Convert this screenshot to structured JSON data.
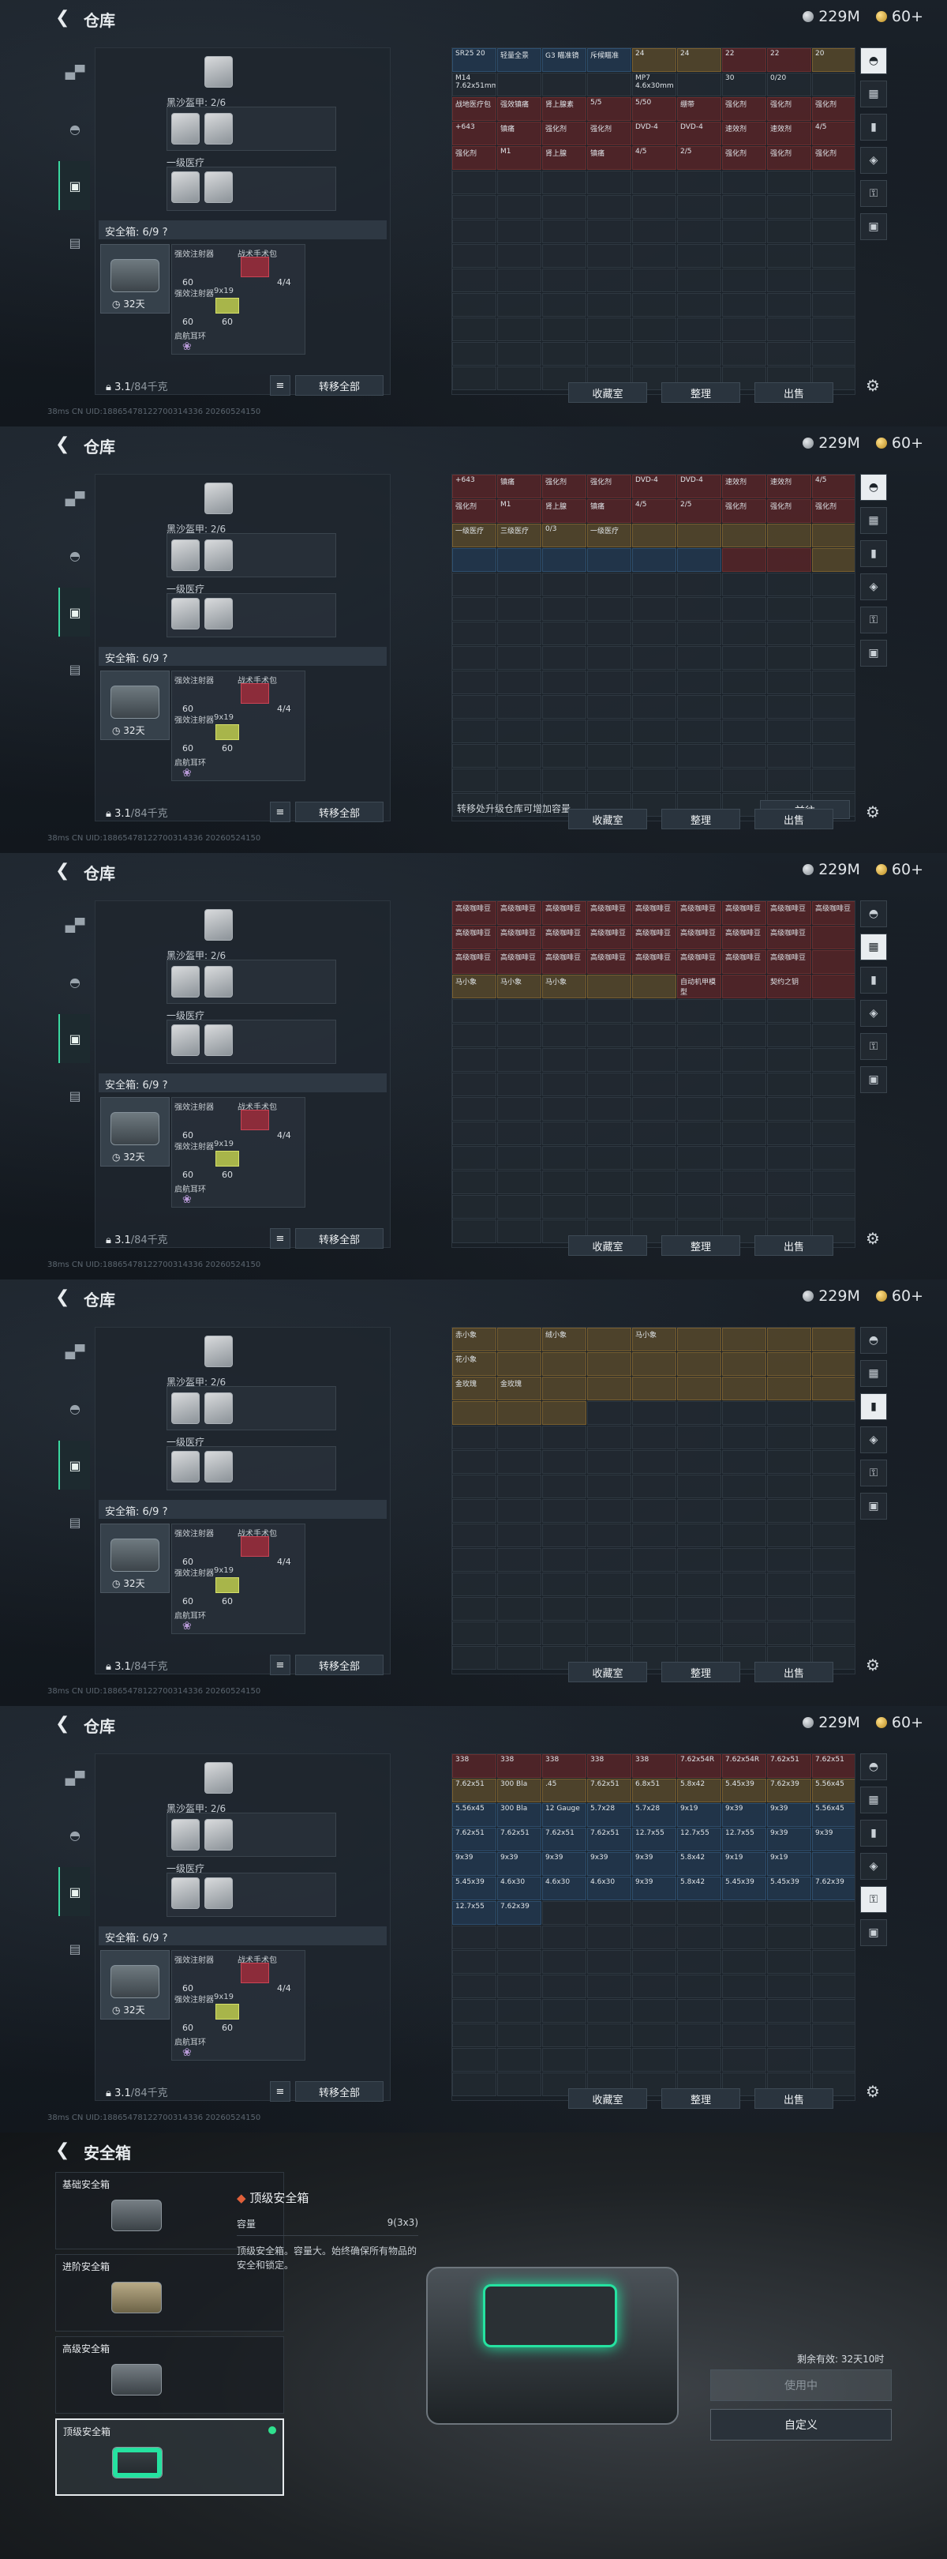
{
  "app": {
    "warehouse_title": "仓库",
    "safe_title": "安全箱",
    "silver": "229M",
    "gold": "60+",
    "uid_text": "CN UID:18865478122700314336 20260524150",
    "ping": "38ms"
  },
  "left_panel": {
    "rig_label": "黑沙盔甲: 2/6",
    "pouch_label": "一级医疗",
    "safe_label": "安全箱: 6/9 ?",
    "safe_time": "32天",
    "items": [
      {
        "name": "强效注射器",
        "count": "60"
      },
      {
        "name": "战术手术包",
        "count": "4/4"
      },
      {
        "name": "强效注射器",
        "count": "60"
      },
      {
        "name": "9x19",
        "count": "60"
      },
      {
        "name": "启航耳环",
        "count": ""
      }
    ],
    "weight": "3.1",
    "weight_max": "/84千克",
    "transfer_all": "转移全部"
  },
  "right_buttons": {
    "stash": "收藏室",
    "sort": "整理",
    "sell": "出售",
    "next": "前往"
  },
  "frames": [
    {
      "note": "",
      "tiles": [
        {
          "t": "SR25 20",
          "c": "blue"
        },
        {
          "t": "轻量全景",
          "c": "blue"
        },
        {
          "t": "G3 瞄准镜",
          "c": "blue"
        },
        {
          "t": "斥候瞄准",
          "c": "blue"
        },
        {
          "t": "24",
          "c": "gold"
        },
        {
          "t": "24",
          "c": "gold"
        },
        {
          "t": "22",
          "c": "red"
        },
        {
          "t": "22",
          "c": "red"
        },
        {
          "t": "20",
          "c": "gold"
        },
        {
          "t": "M14 7.62x51mm",
          "c": ""
        },
        {
          "t": "",
          "c": ""
        },
        {
          "t": "",
          "c": ""
        },
        {
          "t": "",
          "c": ""
        },
        {
          "t": "MP7 4.6x30mm",
          "c": ""
        },
        {
          "t": "",
          "c": ""
        },
        {
          "t": "30",
          "c": ""
        },
        {
          "t": "0/20",
          "c": ""
        },
        {
          "t": "",
          "c": ""
        },
        {
          "t": "战地医疗包",
          "c": "red"
        },
        {
          "t": "强效镇痛",
          "c": "red"
        },
        {
          "t": "肾上腺素",
          "c": "red"
        },
        {
          "t": "5/5",
          "c": "red"
        },
        {
          "t": "5/50",
          "c": "red"
        },
        {
          "t": "绷带",
          "c": "red"
        },
        {
          "t": "强化剂",
          "c": "red"
        },
        {
          "t": "强化剂",
          "c": "red"
        },
        {
          "t": "强化剂",
          "c": "red"
        },
        {
          "t": "+643",
          "c": "red"
        },
        {
          "t": "镇痛",
          "c": "red"
        },
        {
          "t": "强化剂",
          "c": "red"
        },
        {
          "t": "强化剂",
          "c": "red"
        },
        {
          "t": "DVD-4",
          "c": "red"
        },
        {
          "t": "DVD-4",
          "c": "red"
        },
        {
          "t": "速效剂",
          "c": "red"
        },
        {
          "t": "速效剂",
          "c": "red"
        },
        {
          "t": "4/5",
          "c": "red"
        },
        {
          "t": "强化剂",
          "c": "red"
        },
        {
          "t": "M1",
          "c": "red"
        },
        {
          "t": "肾上腺",
          "c": "red"
        },
        {
          "t": "镇痛",
          "c": "red"
        },
        {
          "t": "4/5",
          "c": "red"
        },
        {
          "t": "2/5",
          "c": "red"
        },
        {
          "t": "强化剂",
          "c": "red"
        },
        {
          "t": "强化剂",
          "c": "red"
        },
        {
          "t": "强化剂",
          "c": "red"
        }
      ]
    },
    {
      "note": "转移处升级仓库可增加容量",
      "tiles": [
        {
          "t": "+643",
          "c": "red"
        },
        {
          "t": "镇痛",
          "c": "red"
        },
        {
          "t": "强化剂",
          "c": "red"
        },
        {
          "t": "强化剂",
          "c": "red"
        },
        {
          "t": "DVD-4",
          "c": "red"
        },
        {
          "t": "DVD-4",
          "c": "red"
        },
        {
          "t": "速效剂",
          "c": "red"
        },
        {
          "t": "速效剂",
          "c": "red"
        },
        {
          "t": "4/5",
          "c": "red"
        },
        {
          "t": "强化剂",
          "c": "red"
        },
        {
          "t": "M1",
          "c": "red"
        },
        {
          "t": "肾上腺",
          "c": "red"
        },
        {
          "t": "镇痛",
          "c": "red"
        },
        {
          "t": "4/5",
          "c": "red"
        },
        {
          "t": "2/5",
          "c": "red"
        },
        {
          "t": "强化剂",
          "c": "red"
        },
        {
          "t": "强化剂",
          "c": "red"
        },
        {
          "t": "强化剂",
          "c": "red"
        },
        {
          "t": "一级医疗",
          "c": "gold"
        },
        {
          "t": "三级医疗",
          "c": "gold"
        },
        {
          "t": "0/3",
          "c": "gold"
        },
        {
          "t": "一级医疗",
          "c": "gold"
        },
        {
          "t": "",
          "c": "gold"
        },
        {
          "t": "",
          "c": "gold"
        },
        {
          "t": "",
          "c": "gold"
        },
        {
          "t": "",
          "c": "gold"
        },
        {
          "t": "",
          "c": "gold"
        },
        {
          "t": "",
          "c": "blue"
        },
        {
          "t": "",
          "c": "blue"
        },
        {
          "t": "",
          "c": "blue"
        },
        {
          "t": "",
          "c": "blue"
        },
        {
          "t": "",
          "c": "blue"
        },
        {
          "t": "",
          "c": "blue"
        },
        {
          "t": "",
          "c": "red"
        },
        {
          "t": "",
          "c": "red"
        },
        {
          "t": "",
          "c": "gold"
        }
      ]
    },
    {
      "note": "",
      "tiles": [
        {
          "t": "高级咖啡豆",
          "c": "red"
        },
        {
          "t": "高级咖啡豆",
          "c": "red"
        },
        {
          "t": "高级咖啡豆",
          "c": "red"
        },
        {
          "t": "高级咖啡豆",
          "c": "red"
        },
        {
          "t": "高级咖啡豆",
          "c": "red"
        },
        {
          "t": "高级咖啡豆",
          "c": "red"
        },
        {
          "t": "高级咖啡豆",
          "c": "red"
        },
        {
          "t": "高级咖啡豆",
          "c": "red"
        },
        {
          "t": "高级咖啡豆",
          "c": "red"
        },
        {
          "t": "高级咖啡豆",
          "c": "red"
        },
        {
          "t": "高级咖啡豆",
          "c": "red"
        },
        {
          "t": "高级咖啡豆",
          "c": "red"
        },
        {
          "t": "高级咖啡豆",
          "c": "red"
        },
        {
          "t": "高级咖啡豆",
          "c": "red"
        },
        {
          "t": "高级咖啡豆",
          "c": "red"
        },
        {
          "t": "高级咖啡豆",
          "c": "red"
        },
        {
          "t": "高级咖啡豆",
          "c": "red"
        },
        {
          "t": "",
          "c": "red"
        },
        {
          "t": "高级咖啡豆",
          "c": "red"
        },
        {
          "t": "高级咖啡豆",
          "c": "red"
        },
        {
          "t": "高级咖啡豆",
          "c": "red"
        },
        {
          "t": "高级咖啡豆",
          "c": "red"
        },
        {
          "t": "高级咖啡豆",
          "c": "red"
        },
        {
          "t": "高级咖啡豆",
          "c": "red"
        },
        {
          "t": "高级咖啡豆",
          "c": "red"
        },
        {
          "t": "高级咖啡豆",
          "c": "red"
        },
        {
          "t": "",
          "c": "red"
        },
        {
          "t": "马小象",
          "c": "gold"
        },
        {
          "t": "马小象",
          "c": "gold"
        },
        {
          "t": "马小象",
          "c": "gold"
        },
        {
          "t": "",
          "c": "gold"
        },
        {
          "t": "",
          "c": "gold"
        },
        {
          "t": "自动机甲模型",
          "c": "red"
        },
        {
          "t": "",
          "c": "red"
        },
        {
          "t": "契约之钥",
          "c": "red"
        },
        {
          "t": "",
          "c": "red"
        }
      ]
    },
    {
      "note": "",
      "tiles": [
        {
          "t": "赤小象",
          "c": "gold"
        },
        {
          "t": "",
          "c": "gold"
        },
        {
          "t": "绒小象",
          "c": "gold"
        },
        {
          "t": "",
          "c": "gold"
        },
        {
          "t": "马小象",
          "c": "gold"
        },
        {
          "t": "",
          "c": "gold"
        },
        {
          "t": "",
          "c": "gold"
        },
        {
          "t": "",
          "c": "gold"
        },
        {
          "t": "",
          "c": "gold"
        },
        {
          "t": "花小象",
          "c": "gold"
        },
        {
          "t": "",
          "c": "gold"
        },
        {
          "t": "",
          "c": "gold"
        },
        {
          "t": "",
          "c": "gold"
        },
        {
          "t": "",
          "c": "gold"
        },
        {
          "t": "",
          "c": "gold"
        },
        {
          "t": "",
          "c": "gold"
        },
        {
          "t": "",
          "c": "gold"
        },
        {
          "t": "",
          "c": "gold"
        },
        {
          "t": "金玫瑰",
          "c": "gold"
        },
        {
          "t": "金玫瑰",
          "c": "gold"
        },
        {
          "t": "",
          "c": "gold"
        },
        {
          "t": "",
          "c": "gold"
        },
        {
          "t": "",
          "c": "gold"
        },
        {
          "t": "",
          "c": "gold"
        },
        {
          "t": "",
          "c": "gold"
        },
        {
          "t": "",
          "c": "gold"
        },
        {
          "t": "",
          "c": "gold"
        },
        {
          "t": "",
          "c": "gold"
        },
        {
          "t": "",
          "c": "gold"
        },
        {
          "t": "",
          "c": "gold"
        },
        {
          "t": "",
          "c": ""
        },
        {
          "t": "",
          "c": ""
        },
        {
          "t": "",
          "c": ""
        },
        {
          "t": "",
          "c": ""
        },
        {
          "t": "",
          "c": ""
        },
        {
          "t": "",
          "c": ""
        }
      ]
    },
    {
      "note": "",
      "tiles": [
        {
          "t": "338",
          "c": "red"
        },
        {
          "t": "338",
          "c": "red"
        },
        {
          "t": "338",
          "c": "red"
        },
        {
          "t": "338",
          "c": "red"
        },
        {
          "t": "338",
          "c": "red"
        },
        {
          "t": "7.62x54R",
          "c": "red"
        },
        {
          "t": "7.62x54R",
          "c": "red"
        },
        {
          "t": "7.62x51",
          "c": "red"
        },
        {
          "t": "7.62x51",
          "c": "red"
        },
        {
          "t": "7.62x51",
          "c": "gold"
        },
        {
          "t": "300 Bla",
          "c": "gold"
        },
        {
          "t": ".45",
          "c": "gold"
        },
        {
          "t": "7.62x51",
          "c": "gold"
        },
        {
          "t": "6.8x51",
          "c": "gold"
        },
        {
          "t": "5.8x42",
          "c": "gold"
        },
        {
          "t": "5.45x39",
          "c": "gold"
        },
        {
          "t": "7.62x39",
          "c": "gold"
        },
        {
          "t": "5.56x45",
          "c": "gold"
        },
        {
          "t": "5.56x45",
          "c": "blue"
        },
        {
          "t": "300 Bla",
          "c": "blue"
        },
        {
          "t": "12 Gauge",
          "c": "blue"
        },
        {
          "t": "5.7x28",
          "c": "blue"
        },
        {
          "t": "5.7x28",
          "c": "blue"
        },
        {
          "t": "9x19",
          "c": "blue"
        },
        {
          "t": "9x39",
          "c": "blue"
        },
        {
          "t": "9x39",
          "c": "blue"
        },
        {
          "t": "5.56x45",
          "c": "blue"
        },
        {
          "t": "7.62x51",
          "c": "blue"
        },
        {
          "t": "7.62x51",
          "c": "blue"
        },
        {
          "t": "7.62x51",
          "c": "blue"
        },
        {
          "t": "7.62x51",
          "c": "blue"
        },
        {
          "t": "12.7x55",
          "c": "blue"
        },
        {
          "t": "12.7x55",
          "c": "blue"
        },
        {
          "t": "12.7x55",
          "c": "blue"
        },
        {
          "t": "9x39",
          "c": "blue"
        },
        {
          "t": "9x39",
          "c": "blue"
        },
        {
          "t": "9x39",
          "c": "blue"
        },
        {
          "t": "9x39",
          "c": "blue"
        },
        {
          "t": "9x39",
          "c": "blue"
        },
        {
          "t": "9x39",
          "c": "blue"
        },
        {
          "t": "9x39",
          "c": "blue"
        },
        {
          "t": "5.8x42",
          "c": "blue"
        },
        {
          "t": "9x19",
          "c": "blue"
        },
        {
          "t": "9x19",
          "c": "blue"
        },
        {
          "t": "",
          "c": "blue"
        },
        {
          "t": "5.45x39",
          "c": "blue"
        },
        {
          "t": "4.6x30",
          "c": "blue"
        },
        {
          "t": "4.6x30",
          "c": "blue"
        },
        {
          "t": "4.6x30",
          "c": "blue"
        },
        {
          "t": "9x39",
          "c": "blue"
        },
        {
          "t": "5.8x42",
          "c": "blue"
        },
        {
          "t": "5.45x39",
          "c": "blue"
        },
        {
          "t": "5.45x39",
          "c": "blue"
        },
        {
          "t": "7.62x39",
          "c": "blue"
        },
        {
          "t": "12.7x55",
          "c": "blue"
        },
        {
          "t": "7.62x39",
          "c": "blue"
        },
        {
          "t": "",
          "c": ""
        },
        {
          "t": "",
          "c": ""
        },
        {
          "t": "",
          "c": ""
        },
        {
          "t": "",
          "c": ""
        },
        {
          "t": "",
          "c": ""
        },
        {
          "t": "",
          "c": ""
        },
        {
          "t": "",
          "c": ""
        }
      ]
    }
  ],
  "safe_screen": {
    "items": [
      {
        "label": "基础安全箱",
        "active": false
      },
      {
        "label": "进阶安全箱",
        "active": false
      },
      {
        "label": "高级安全箱",
        "active": false
      },
      {
        "label": "顶级安全箱",
        "active": true
      }
    ],
    "detail_title": "顶级安全箱",
    "capacity_label": "容量",
    "capacity_value": "9(3x3)",
    "description": "顶级安全箱。容量大。始终确保所有物品的安全和锁定。",
    "timer": "剩余有效: 32天10时",
    "use_button": "使用中",
    "custom_button": "自定义"
  }
}
